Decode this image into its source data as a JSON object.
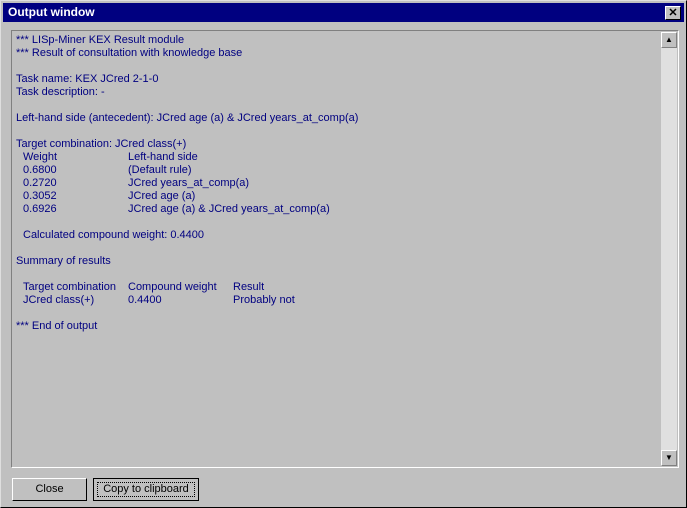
{
  "window": {
    "title": "Output window",
    "close_glyph": "✕"
  },
  "output": {
    "header1": "*** LISp-Miner KEX Result module",
    "header2": "*** Result of consultation with knowledge base",
    "task_name": "Task name: KEX JCred 2-1-0",
    "task_description": "Task description: -",
    "lhs": "Left-hand side (antecedent): JCred age (a) & JCred years_at_comp(a)",
    "target": "Target combination: JCred class(+)",
    "weights_table": {
      "headers": [
        "Weight",
        "Left-hand side"
      ],
      "rows": [
        [
          "0.6800",
          "(Default rule)"
        ],
        [
          "0.2720",
          "JCred years_at_comp(a)"
        ],
        [
          "0.3052",
          "JCred age (a)"
        ],
        [
          "0.6926",
          "JCred age (a) & JCred years_at_comp(a)"
        ]
      ]
    },
    "calculated": "Calculated compound weight: 0.4400",
    "summary_title": "Summary of results",
    "summary_table": {
      "headers": [
        "Target combination",
        "Compound weight",
        "Result"
      ],
      "rows": [
        [
          "JCred class(+)",
          "0.4400",
          "Probably not"
        ]
      ]
    },
    "end": "*** End of output"
  },
  "buttons": {
    "close_label": "Close",
    "copy_label": "Copy to clipboard"
  },
  "icons": {
    "scroll_up": "triangle-up",
    "scroll_down": "triangle-down"
  }
}
